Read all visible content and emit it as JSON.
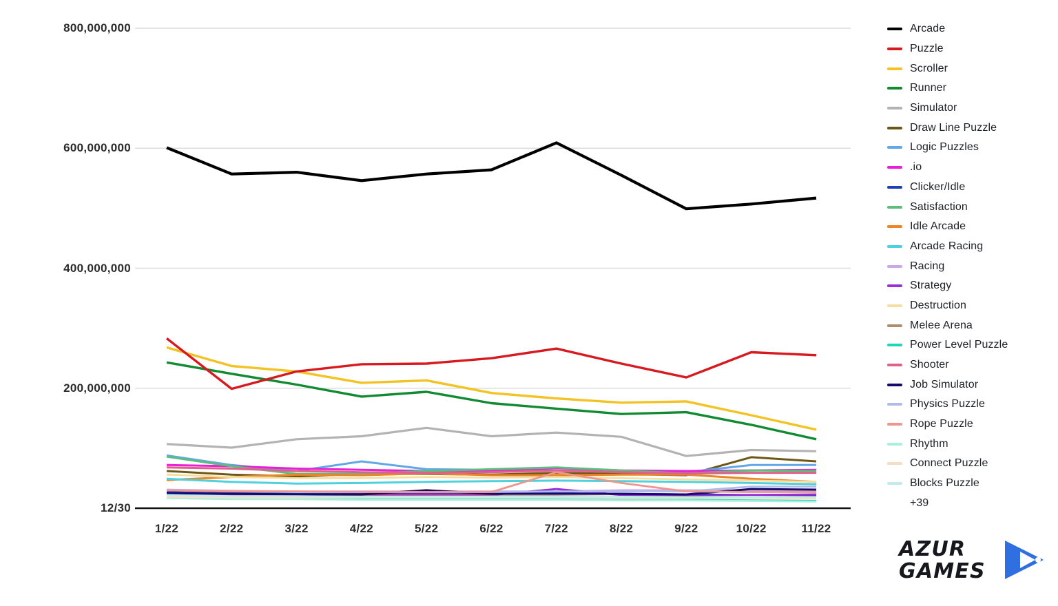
{
  "legend": {
    "more_label": "+39",
    "items": [
      {
        "label": "Arcade",
        "color": "#000000"
      },
      {
        "label": "Puzzle",
        "color": "#d71920"
      },
      {
        "label": "Scroller",
        "color": "#f2c323"
      },
      {
        "label": "Runner",
        "color": "#118a32"
      },
      {
        "label": "Simulator",
        "color": "#b3b3b3"
      },
      {
        "label": "Draw Line Puzzle",
        "color": "#6e5616"
      },
      {
        "label": "Logic Puzzles",
        "color": "#62a8e8"
      },
      {
        "label": ".io",
        "color": "#e81fd6"
      },
      {
        "label": "Clicker/Idle",
        "color": "#1b3fb5"
      },
      {
        "label": "Satisfaction",
        "color": "#5cbd7c"
      },
      {
        "label": "Idle Arcade",
        "color": "#e88628"
      },
      {
        "label": "Arcade Racing",
        "color": "#4fd0dd"
      },
      {
        "label": "Racing",
        "color": "#cba8e8"
      },
      {
        "label": "Strategy",
        "color": "#9930d6"
      },
      {
        "label": "Destruction",
        "color": "#f5dfa0"
      },
      {
        "label": "Melee Arena",
        "color": "#b08c6e"
      },
      {
        "label": "Power Level Puzzle",
        "color": "#1fd6ba"
      },
      {
        "label": "Shooter",
        "color": "#e0608c"
      },
      {
        "label": "Job Simulator",
        "color": "#140a6e"
      },
      {
        "label": "Physics Puzzle",
        "color": "#b0bce8"
      },
      {
        "label": "Rope Puzzle",
        "color": "#f0958c"
      },
      {
        "label": "Rhythm",
        "color": "#a8f0dd"
      },
      {
        "label": "Connect Puzzle",
        "color": "#f7ddc3"
      },
      {
        "label": "Blocks Puzzle",
        "color": "#c3ebeb"
      }
    ]
  },
  "logo": {
    "line1": "AZUR",
    "line2": "GAMES",
    "mark_color": "#2f6fe0"
  },
  "chart_data": {
    "type": "line",
    "title": "",
    "xlabel": "",
    "ylabel": "",
    "grid": true,
    "legend_position": "right",
    "ylim": [
      0,
      800000000
    ],
    "yticks": [
      800000000,
      600000000,
      400000000,
      200000000
    ],
    "ytick_labels": [
      "800,000,000",
      "600,000,000",
      "400,000,000",
      "200,000,000"
    ],
    "axis_origin_label": "12/30",
    "categories": [
      "1/22",
      "2/22",
      "3/22",
      "4/22",
      "5/22",
      "6/22",
      "7/22",
      "8/22",
      "9/22",
      "10/22",
      "11/22"
    ],
    "series": [
      {
        "name": "Arcade",
        "color": "#000000",
        "width": 4.2,
        "values": [
          601000000,
          557000000,
          560000000,
          546000000,
          557000000,
          564000000,
          609000000,
          555000000,
          499000000,
          507000000,
          517000000
        ]
      },
      {
        "name": "Puzzle",
        "color": "#d71920",
        "width": 3.4,
        "values": [
          283000000,
          199000000,
          228000000,
          240000000,
          241000000,
          250000000,
          266000000,
          241000000,
          218000000,
          260000000,
          255000000
        ]
      },
      {
        "name": "Scroller",
        "color": "#f2c323",
        "width": 3.4,
        "values": [
          268000000,
          237000000,
          228000000,
          209000000,
          213000000,
          192000000,
          183000000,
          176000000,
          178000000,
          155000000,
          131000000
        ]
      },
      {
        "name": "Runner",
        "color": "#118a32",
        "width": 3.4,
        "values": [
          243000000,
          224000000,
          206000000,
          186000000,
          194000000,
          175000000,
          166000000,
          157000000,
          160000000,
          139000000,
          115000000
        ]
      },
      {
        "name": "Simulator",
        "color": "#b3b3b3",
        "width": 3.2,
        "values": [
          107000000,
          101000000,
          115000000,
          120000000,
          134000000,
          120000000,
          126000000,
          119000000,
          87000000,
          97000000,
          95000000
        ]
      },
      {
        "name": "Draw Line Puzzle",
        "color": "#6e5616",
        "width": 3.0,
        "values": [
          62000000,
          56000000,
          53000000,
          57000000,
          57000000,
          56000000,
          59000000,
          57000000,
          55000000,
          85000000,
          78000000
        ]
      },
      {
        "name": "Logic Puzzles",
        "color": "#62a8e8",
        "width": 3.0,
        "values": [
          88000000,
          72000000,
          62000000,
          78000000,
          65000000,
          64000000,
          63000000,
          62000000,
          60000000,
          72000000,
          72000000
        ]
      },
      {
        "name": ".io",
        "color": "#e81fd6",
        "width": 3.0,
        "values": [
          72000000,
          70000000,
          66000000,
          64000000,
          62000000,
          62000000,
          67000000,
          63000000,
          62000000,
          63000000,
          64000000
        ]
      },
      {
        "name": "Clicker/Idle",
        "color": "#1b3fb5",
        "width": 2.8,
        "values": [
          27000000,
          25000000,
          24000000,
          24000000,
          25000000,
          25000000,
          25000000,
          24000000,
          23000000,
          22000000,
          21000000
        ]
      },
      {
        "name": "Satisfaction",
        "color": "#5cbd7c",
        "width": 3.0,
        "values": [
          86000000,
          70000000,
          57000000,
          57000000,
          62000000,
          65000000,
          68000000,
          63000000,
          58000000,
          63000000,
          62000000
        ]
      },
      {
        "name": "Idle Arcade",
        "color": "#e88628",
        "width": 3.0,
        "values": [
          47000000,
          52000000,
          56000000,
          55000000,
          58000000,
          55000000,
          55000000,
          56000000,
          56000000,
          49000000,
          44000000
        ]
      },
      {
        "name": "Arcade Racing",
        "color": "#4fd0dd",
        "width": 3.0,
        "values": [
          49000000,
          44000000,
          41000000,
          42000000,
          44000000,
          45000000,
          46000000,
          45000000,
          44000000,
          42000000,
          40000000
        ]
      },
      {
        "name": "Racing",
        "color": "#cba8e8",
        "width": 2.8,
        "values": [
          31000000,
          29000000,
          28000000,
          28000000,
          28000000,
          28000000,
          28000000,
          30000000,
          30000000,
          30000000,
          29000000
        ]
      },
      {
        "name": "Strategy",
        "color": "#9930d6",
        "width": 3.0,
        "values": [
          21000000,
          21000000,
          21000000,
          22000000,
          23000000,
          22000000,
          32000000,
          22000000,
          20000000,
          22000000,
          23000000
        ]
      },
      {
        "name": "Destruction",
        "color": "#f5dfa0",
        "width": 2.8,
        "values": [
          56000000,
          52000000,
          50000000,
          50000000,
          52000000,
          51000000,
          52000000,
          50000000,
          48000000,
          46000000,
          44000000
        ]
      },
      {
        "name": "Melee Arena",
        "color": "#b08c6e",
        "width": 2.8,
        "values": [
          22000000,
          20000000,
          20000000,
          20000000,
          20000000,
          20000000,
          20000000,
          19000000,
          19000000,
          19000000,
          19000000
        ]
      },
      {
        "name": "Power Level Puzzle",
        "color": "#1fd6ba",
        "width": 3.0,
        "values": [
          18000000,
          16000000,
          16000000,
          16000000,
          16000000,
          16000000,
          15000000,
          15000000,
          14000000,
          13000000,
          12000000
        ]
      },
      {
        "name": "Shooter",
        "color": "#e0608c",
        "width": 3.0,
        "values": [
          68000000,
          66000000,
          62000000,
          60000000,
          59000000,
          60000000,
          63000000,
          60000000,
          58000000,
          59000000,
          59000000
        ]
      },
      {
        "name": "Job Simulator",
        "color": "#140a6e",
        "width": 3.0,
        "values": [
          25000000,
          24000000,
          23000000,
          23000000,
          30000000,
          24000000,
          24000000,
          24000000,
          23000000,
          32000000,
          31000000
        ]
      },
      {
        "name": "Physics Puzzle",
        "color": "#b0bce8",
        "width": 2.8,
        "values": [
          30000000,
          28000000,
          27000000,
          27000000,
          27000000,
          27000000,
          28000000,
          28000000,
          28000000,
          36000000,
          36000000
        ]
      },
      {
        "name": "Rope Puzzle",
        "color": "#f0958c",
        "width": 2.8,
        "values": [
          30000000,
          28000000,
          28000000,
          27000000,
          27000000,
          27000000,
          60000000,
          42000000,
          28000000,
          27000000,
          27000000
        ]
      },
      {
        "name": "Rhythm",
        "color": "#a8f0dd",
        "width": 2.8,
        "values": [
          17000000,
          15000000,
          15000000,
          14000000,
          14000000,
          14000000,
          14000000,
          13000000,
          13000000,
          12000000,
          11000000
        ]
      },
      {
        "name": "Connect Puzzle",
        "color": "#f7ddc3",
        "width": 2.8,
        "values": [
          19000000,
          18000000,
          18000000,
          18000000,
          18000000,
          18000000,
          18000000,
          17000000,
          17000000,
          17000000,
          16000000
        ]
      },
      {
        "name": "Blocks Puzzle",
        "color": "#c3ebeb",
        "width": 2.8,
        "values": [
          22000000,
          20000000,
          20000000,
          19000000,
          19000000,
          19000000,
          19000000,
          19000000,
          18000000,
          19000000,
          18000000
        ]
      }
    ]
  }
}
